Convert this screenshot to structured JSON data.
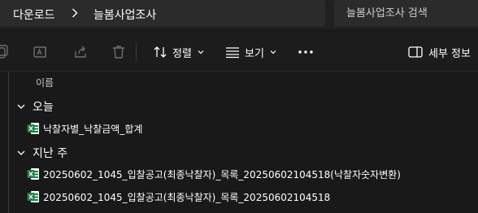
{
  "address_bar": {
    "breadcrumbs": [
      "다운로드",
      "늘봄사업조사"
    ],
    "search_placeholder": "늘봄사업조사 검색"
  },
  "command_bar": {
    "sort_label": "정렬",
    "view_label": "보기",
    "details_label": "세부 정보"
  },
  "file_list": {
    "column_header": "이름",
    "groups": [
      {
        "label": "오늘",
        "files": [
          "낙찰자별_낙찰금액_합계"
        ]
      },
      {
        "label": "지난 주",
        "files": [
          "20250602_1045_입찰공고(최종낙찰자)_목록_20250602104518(낙찰자숫자변환)",
          "20250602_1045_입찰공고(최종낙찰자)_목록_20250602104518"
        ]
      }
    ]
  },
  "colors": {
    "background": "#191919",
    "excel_green": "#1d7f45",
    "text": "#ffffff",
    "muted_icon": "#6e6e6e"
  }
}
